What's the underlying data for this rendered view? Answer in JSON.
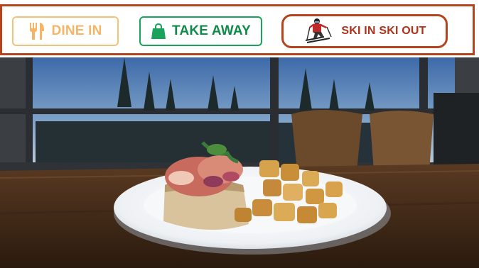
{
  "banner": {
    "dine_in": {
      "label": "DINE IN",
      "icon": "fork-knife-icon",
      "color": "#f6b566"
    },
    "take_away": {
      "label": "TAKE AWAY",
      "icon": "shopping-bag-icon",
      "color": "#0f8a4a"
    },
    "ski_in_ski_out": {
      "label": "SKI IN SKI OUT",
      "icon": "skier-icon",
      "color": "#b0301a"
    }
  },
  "photo": {
    "subject": "bruschetta-plate-with-roasted-potatoes"
  },
  "colors": {
    "border": "#b3441e"
  }
}
